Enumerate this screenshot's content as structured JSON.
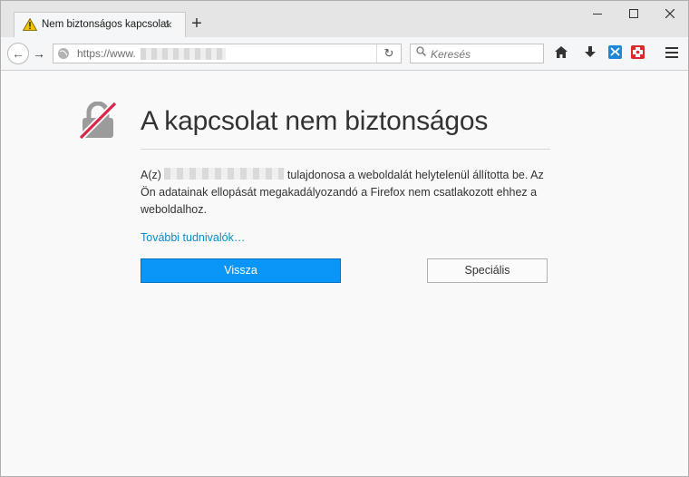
{
  "tab": {
    "title": "Nem biztonságos kapcsolat",
    "close_icon": "×",
    "new_tab_icon": "+"
  },
  "window_controls": {
    "minimize": "—",
    "maximize": "☐",
    "close": "✕"
  },
  "navbar": {
    "back_icon": "←",
    "forward_icon": "→",
    "url_prefix": "https://www.",
    "reload_icon": "↻",
    "search_placeholder": "Keresés",
    "search_icon": "🔍",
    "home_icon": "⌂",
    "download_icon": "⬇",
    "menu_icon": "☰"
  },
  "page": {
    "heading": "A kapcsolat nem biztonságos",
    "paragraph_prefix": "A(z)",
    "paragraph_suffix": "tulajdonosa a weboldalát helytelenül állította be. Az Ön adatainak ellopását megakadályozandó a Firefox nem csatlakozott ehhez a weboldalhoz.",
    "more_link": "További tudnivalók…",
    "back_button": "Vissza",
    "advanced_button": "Speciális"
  },
  "colors": {
    "accent": "#0996f8",
    "link": "#0a8dcc",
    "lock_gray": "#9b9b9b",
    "slash_red": "#d7264a"
  }
}
